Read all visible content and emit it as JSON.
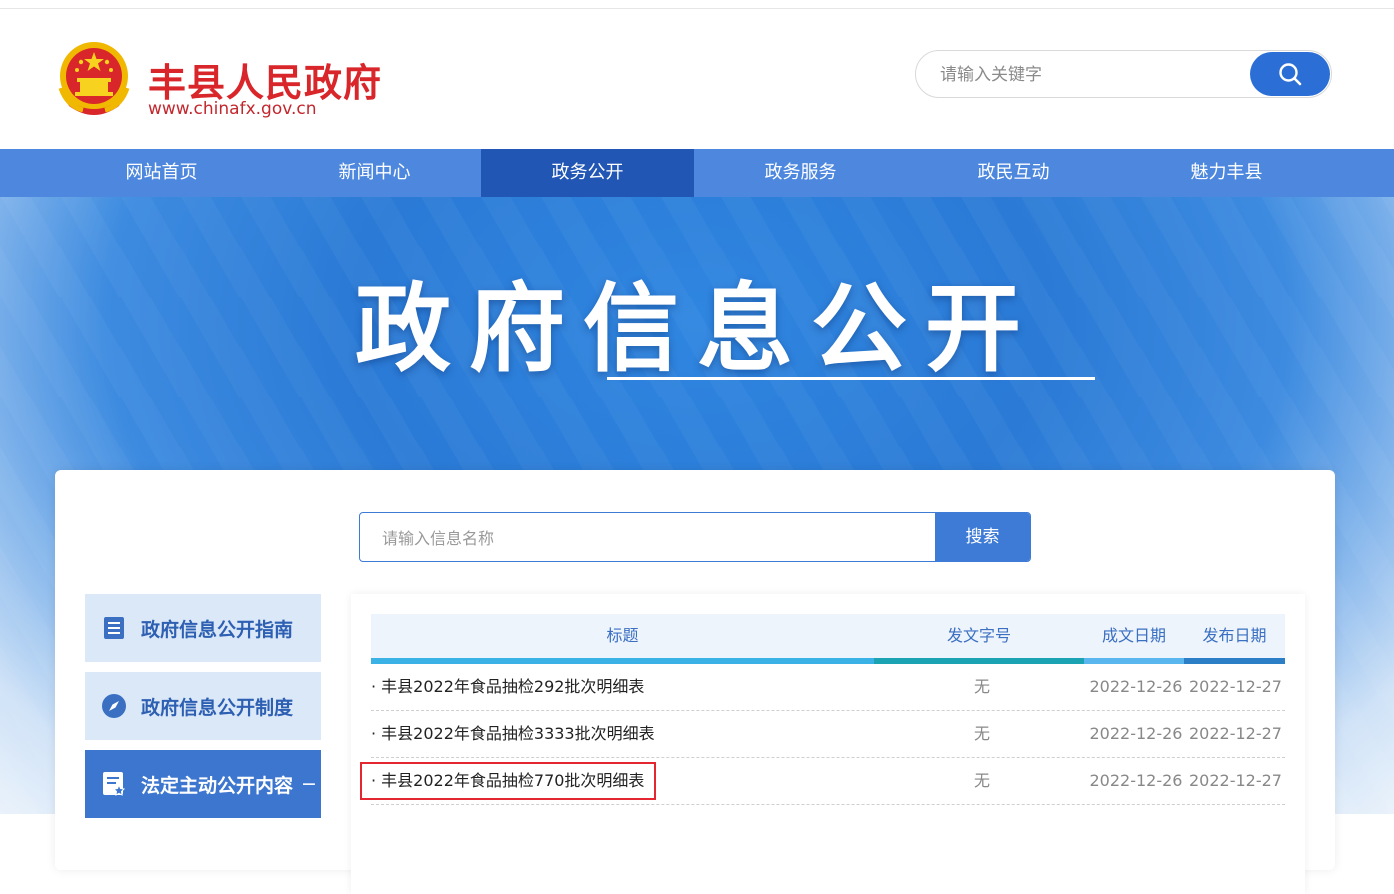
{
  "header": {
    "site_title": "丰县人民政府",
    "site_url": "www.chinafx.gov.cn",
    "search_placeholder": "请输入关键字"
  },
  "nav": {
    "items": [
      {
        "label": "网站首页"
      },
      {
        "label": "新闻中心"
      },
      {
        "label": "政务公开",
        "active": true
      },
      {
        "label": "政务服务"
      },
      {
        "label": "政民互动"
      },
      {
        "label": "魅力丰县"
      }
    ]
  },
  "banner": {
    "title": "政府信息公开"
  },
  "content_search": {
    "placeholder": "请输入信息名称",
    "button_label": "搜索"
  },
  "sidebar": {
    "items": [
      {
        "label": "政府信息公开指南",
        "icon": "list-icon"
      },
      {
        "label": "政府信息公开制度",
        "icon": "compass-icon"
      },
      {
        "label": "法定主动公开内容",
        "icon": "document-star-icon",
        "active": true,
        "toggle": "−"
      }
    ]
  },
  "table": {
    "headers": {
      "title": "标题",
      "doc_no": "发文字号",
      "written_date": "成文日期",
      "publish_date": "发布日期"
    },
    "rows": [
      {
        "title": "· 丰县2022年食品抽检292批次明细表",
        "doc_no": "无",
        "written_date": "2022-12-26",
        "publish_date": "2022-12-27"
      },
      {
        "title": "· 丰县2022年食品抽检3333批次明细表",
        "doc_no": "无",
        "written_date": "2022-12-26",
        "publish_date": "2022-12-27"
      },
      {
        "title": "· 丰县2022年食品抽检770批次明细表",
        "doc_no": "无",
        "written_date": "2022-12-26",
        "publish_date": "2022-12-27"
      }
    ]
  },
  "colors": {
    "brand_red": "#d8262a",
    "nav_blue": "#4d88de",
    "nav_active": "#2256b5",
    "accent_blue": "#3d7bd6",
    "highlight_red": "#e3262f"
  }
}
